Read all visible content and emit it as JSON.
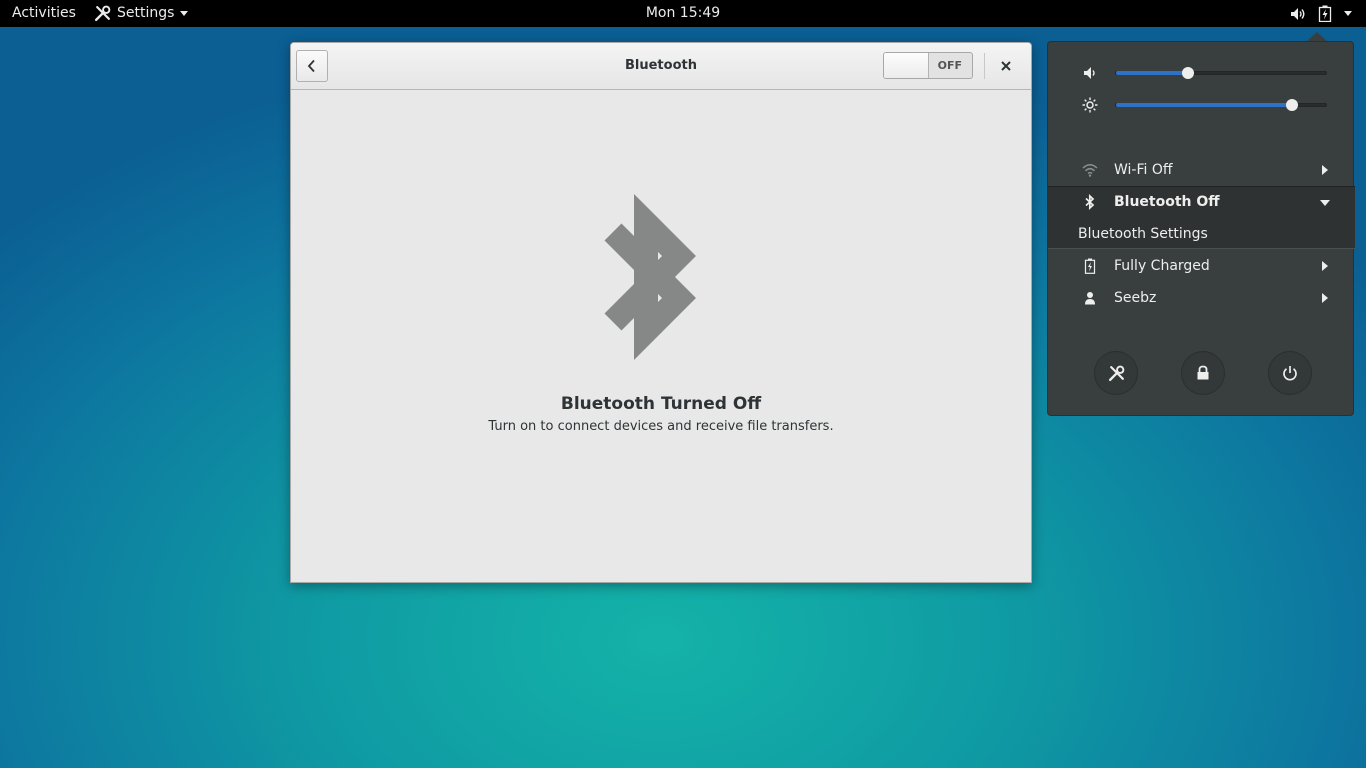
{
  "topbar": {
    "activities": "Activities",
    "app_menu": "Settings",
    "clock": "Mon 15:49"
  },
  "window": {
    "title": "Bluetooth",
    "toggle_state": "OFF",
    "empty_title": "Bluetooth Turned Off",
    "empty_subtitle": "Turn on to connect devices and receive file transfers."
  },
  "status_menu": {
    "volume_level": 0.34,
    "brightness_level": 0.83,
    "wifi": "Wi-Fi Off",
    "bluetooth": "Bluetooth Off",
    "bluetooth_settings": "Bluetooth Settings",
    "battery": "Fully Charged",
    "user": "Seebz",
    "accent_color": "#2f71c9"
  },
  "icons": [
    "settings-tools-icon",
    "volume-icon",
    "battery-icon",
    "back-arrow-icon",
    "close-icon",
    "bluetooth-icon",
    "wifi-icon",
    "brightness-icon",
    "user-icon",
    "lock-icon",
    "power-icon"
  ]
}
